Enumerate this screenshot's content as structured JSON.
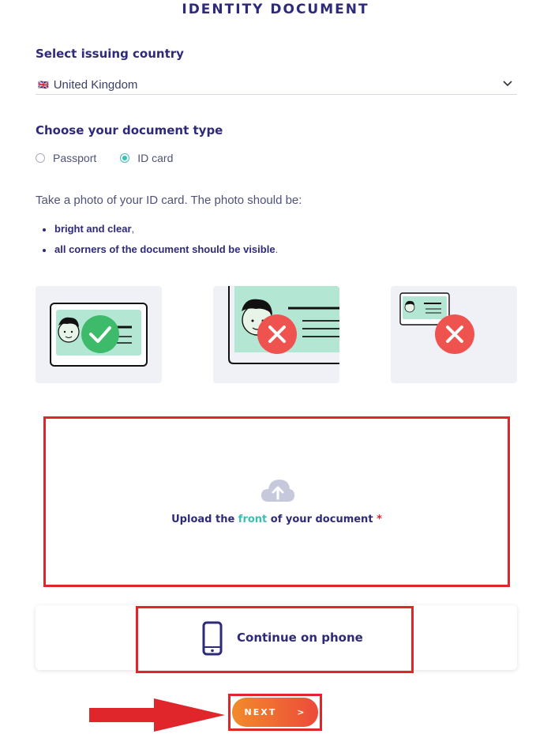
{
  "header": {
    "title": "IDENTITY DOCUMENT"
  },
  "country": {
    "label": "Select issuing country",
    "flag": "🇬🇧",
    "selected": "United Kingdom",
    "icon": "chevron-down-icon"
  },
  "document_type": {
    "label": "Choose your document type",
    "options": [
      {
        "label": "Passport",
        "selected": false
      },
      {
        "label": "ID card",
        "selected": true
      }
    ]
  },
  "instructions": {
    "intro": "Take a photo of your ID card. The photo should be:",
    "bullet1_bold": "bright and clear",
    "bullet1_trail": ",",
    "bullet2_bold": "all corners of the document should be visible",
    "bullet2_trail": "."
  },
  "samples": [
    {
      "kind": "good",
      "icon": "check-icon"
    },
    {
      "kind": "too-close",
      "icon": "x-icon"
    },
    {
      "kind": "too-far",
      "icon": "x-icon"
    }
  ],
  "upload": {
    "prefix": "Upload the ",
    "accent": "front",
    "suffix": " of your document ",
    "required": "*",
    "icon": "cloud-upload-icon"
  },
  "phone": {
    "label": "Continue on phone",
    "icon": "smartphone-icon"
  },
  "next": {
    "label": "NEXT",
    "arrow": ">"
  },
  "colors": {
    "primary": "#2e2a7a",
    "accent": "#3bbfb0",
    "highlight": "#e0252b",
    "button_start": "#f28b2b",
    "button_end": "#ec4a3a"
  }
}
